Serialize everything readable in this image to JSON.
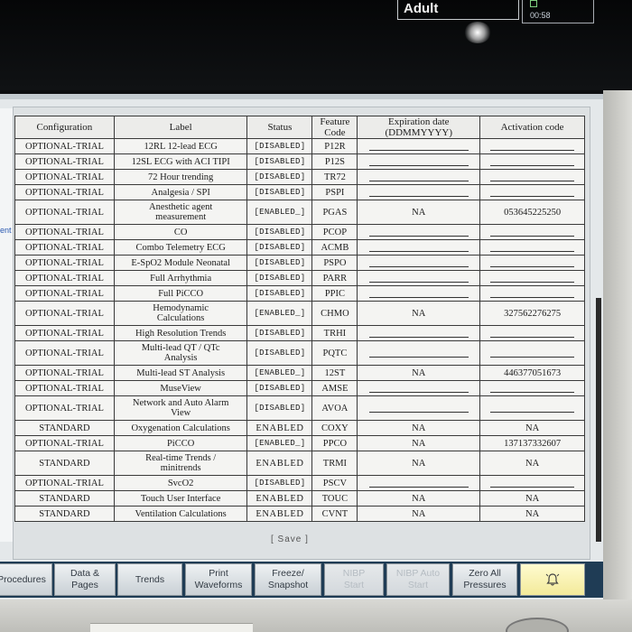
{
  "header": {
    "patient_category": "Adult",
    "clock": "00:58"
  },
  "left_stub_text": "ent",
  "table": {
    "columns": [
      "Configuration",
      "Label",
      "Status",
      "Feature\nCode",
      "Expiration date\n(DDMMYYYY)",
      "Activation code"
    ],
    "rows": [
      {
        "config": "OPTIONAL-TRIAL",
        "label": "12RL 12-lead ECG",
        "status": "[DISABLED]",
        "code": "P12R",
        "expiration": "",
        "activation": ""
      },
      {
        "config": "OPTIONAL-TRIAL",
        "label": "12SL ECG with ACI TIPI",
        "status": "[DISABLED]",
        "code": "P12S",
        "expiration": "",
        "activation": ""
      },
      {
        "config": "OPTIONAL-TRIAL",
        "label": "72 Hour trending",
        "status": "[DISABLED]",
        "code": "TR72",
        "expiration": "",
        "activation": ""
      },
      {
        "config": "OPTIONAL-TRIAL",
        "label": "Analgesia / SPI",
        "status": "[DISABLED]",
        "code": "PSPI",
        "expiration": "",
        "activation": ""
      },
      {
        "config": "OPTIONAL-TRIAL",
        "label": "Anesthetic agent\nmeasurement",
        "status": "[ENABLED_]",
        "code": "PGAS",
        "expiration": "NA",
        "activation": "053645225250",
        "tall": true
      },
      {
        "config": "OPTIONAL-TRIAL",
        "label": "CO",
        "status": "[DISABLED]",
        "code": "PCOP",
        "expiration": "",
        "activation": ""
      },
      {
        "config": "OPTIONAL-TRIAL",
        "label": "Combo Telemetry ECG",
        "status": "[DISABLED]",
        "code": "ACMB",
        "expiration": "",
        "activation": ""
      },
      {
        "config": "OPTIONAL-TRIAL",
        "label": "E-SpO2 Module Neonatal",
        "status": "[DISABLED]",
        "code": "PSPO",
        "expiration": "",
        "activation": ""
      },
      {
        "config": "OPTIONAL-TRIAL",
        "label": "Full Arrhythmia",
        "status": "[DISABLED]",
        "code": "PARR",
        "expiration": "",
        "activation": ""
      },
      {
        "config": "OPTIONAL-TRIAL",
        "label": "Full PiCCO",
        "status": "[DISABLED]",
        "code": "PPIC",
        "expiration": "",
        "activation": ""
      },
      {
        "config": "OPTIONAL-TRIAL",
        "label": "Hemodynamic\nCalculations",
        "status": "[ENABLED_]",
        "code": "CHMO",
        "expiration": "NA",
        "activation": "327562276275",
        "tall": true
      },
      {
        "config": "OPTIONAL-TRIAL",
        "label": "High Resolution Trends",
        "status": "[DISABLED]",
        "code": "TRHI",
        "expiration": "",
        "activation": ""
      },
      {
        "config": "OPTIONAL-TRIAL",
        "label": "Multi-lead QT / QTc\nAnalysis",
        "status": "[DISABLED]",
        "code": "PQTC",
        "expiration": "",
        "activation": "",
        "tall": true
      },
      {
        "config": "OPTIONAL-TRIAL",
        "label": "Multi-lead ST Analysis",
        "status": "[ENABLED_]",
        "code": "12ST",
        "expiration": "NA",
        "activation": "446377051673"
      },
      {
        "config": "OPTIONAL-TRIAL",
        "label": "MuseView",
        "status": "[DISABLED]",
        "code": "AMSE",
        "expiration": "",
        "activation": ""
      },
      {
        "config": "OPTIONAL-TRIAL",
        "label": "Network and Auto Alarm\nView",
        "status": "[DISABLED]",
        "code": "AVOA",
        "expiration": "",
        "activation": "",
        "tall": true
      },
      {
        "config": "STANDARD",
        "label": "Oxygenation Calculations",
        "status": "ENABLED",
        "code": "COXY",
        "expiration": "NA",
        "activation": "NA"
      },
      {
        "config": "OPTIONAL-TRIAL",
        "label": "PiCCO",
        "status": "[ENABLED_]",
        "code": "PPCO",
        "expiration": "NA",
        "activation": "137137332607"
      },
      {
        "config": "STANDARD",
        "label": "Real-time Trends /\nminitrends",
        "status": "ENABLED",
        "code": "TRMI",
        "expiration": "NA",
        "activation": "NA",
        "tall": true
      },
      {
        "config": "OPTIONAL-TRIAL",
        "label": "SvcO2",
        "status": "[DISABLED]",
        "code": "PSCV",
        "expiration": "",
        "activation": ""
      },
      {
        "config": "STANDARD",
        "label": "Touch User Interface",
        "status": "ENABLED",
        "code": "TOUC",
        "expiration": "NA",
        "activation": "NA"
      },
      {
        "config": "STANDARD",
        "label": "Ventilation Calculations",
        "status": "ENABLED",
        "code": "CVNT",
        "expiration": "NA",
        "activation": "NA"
      }
    ]
  },
  "save_label": "[ Save ]",
  "buttons": [
    {
      "label": "Procedures",
      "enabled": true
    },
    {
      "label": "Data &\nPages",
      "enabled": true
    },
    {
      "label": "Trends",
      "enabled": true
    },
    {
      "label": "Print\nWaveforms",
      "enabled": true
    },
    {
      "label": "Freeze/\nSnapshot",
      "enabled": true
    },
    {
      "label": "NIBP\nStart",
      "enabled": false
    },
    {
      "label": "NIBP Auto\nStart",
      "enabled": false
    },
    {
      "label": "Zero All\nPressures",
      "enabled": true
    },
    {
      "label": "",
      "enabled": true,
      "icon": "alarm-bell-icon"
    }
  ],
  "colors": {
    "accent_bar": "#1f3c55",
    "alarm_button": "#f3ea9a"
  }
}
